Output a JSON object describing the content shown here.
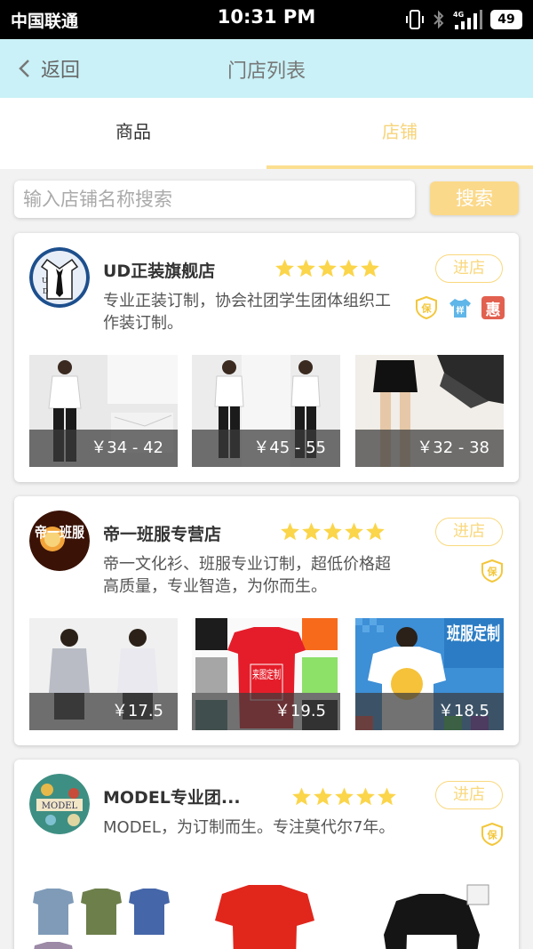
{
  "status": {
    "carrier": "中国联通",
    "time": "10:31 PM",
    "network": "4G",
    "battery": "49"
  },
  "nav": {
    "back_label": "返回",
    "title": "门店列表"
  },
  "tabs": [
    {
      "label": "商品"
    },
    {
      "label": "店铺"
    }
  ],
  "search": {
    "placeholder": "输入店铺名称搜索",
    "button_label": "搜索"
  },
  "colors": {
    "accent": "#fbd98a",
    "nav_bg": "#c9f1f7",
    "star": "#fbd54a",
    "hui_badge": "#e2604f",
    "yang_badge": "#5fb6e8"
  },
  "shops": [
    {
      "name": "UD正装旗舰店",
      "rating": 5,
      "enter_label": "进店",
      "description": "专业正装订制，协会社团学生团体组织工作装订制。",
      "badges": [
        "保",
        "样",
        "惠"
      ],
      "products": [
        {
          "price": "￥34 - 42"
        },
        {
          "price": "￥45 - 55"
        },
        {
          "price": "￥32 - 38"
        }
      ]
    },
    {
      "name": "帝一班服专营店",
      "rating": 5,
      "enter_label": "进店",
      "description": "帝一文化衫、班服专业订制，超低价格超高质量，专业智造，为你而生。",
      "badges": [
        "保"
      ],
      "logo_text": "帝一班服",
      "products": [
        {
          "price": "￥17.5"
        },
        {
          "price": "￥19.5",
          "overlay": "来图定制"
        },
        {
          "price": "￥18.5",
          "overlay": "班服定制"
        }
      ]
    },
    {
      "name": "MODEL专业团...",
      "rating": 5,
      "enter_label": "进店",
      "description": "MODEL，为订制而生。专注莫代尔7年。",
      "badges": [
        "保"
      ],
      "logo_text": "MODEL",
      "products": [
        {},
        {},
        {}
      ]
    }
  ]
}
